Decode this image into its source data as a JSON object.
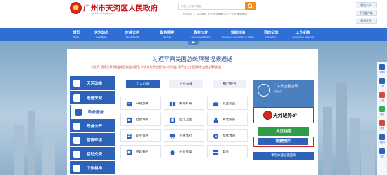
{
  "header": {
    "title": "广州市天河区人民政府",
    "url": "www.thnet.gov.cn",
    "search_placeholder": "请输入关键字搜索",
    "hot_words": "热点词汇：  公共服务   产业扶持政策   学习十九大   营商环境",
    "top_buttons": [
      "微信公众",
      "手机客户端",
      "微博天河"
    ]
  },
  "nav": {
    "items": [
      {
        "zh": "首页",
        "en": "Home"
      },
      {
        "zh": "天河动态",
        "en": "Look News"
      },
      {
        "zh": "走进天河",
        "en": "About Tianhe"
      },
      {
        "zh": "政务服务",
        "en": "Services"
      },
      {
        "zh": "政务公开",
        "en": "Government affairs"
      },
      {
        "zh": "营商环境",
        "en": "Business & Investment in Tianhe"
      },
      {
        "zh": "互动交流",
        "en": "Interaction"
      },
      {
        "zh": "工作机构",
        "en": "Government Agencies"
      }
    ]
  },
  "main": {
    "headline": "习近平同美国总统拜登视频通话",
    "summary": "习近平：国家关系不能变来回或相向而行，冲突对抗不符合任何人的利益，和平安全才是国际社会最宝贵的财富",
    "sidebar": [
      {
        "label": "天河动态",
        "active": false
      },
      {
        "label": "走进天河",
        "active": false
      },
      {
        "label": "政务服务",
        "active": true
      },
      {
        "label": "政务公开",
        "active": false
      },
      {
        "label": "营商环境",
        "active": false
      },
      {
        "label": "互动交流",
        "active": false
      },
      {
        "label": "工作机构",
        "active": false
      }
    ],
    "tabs": [
      "个人办事",
      "企业办事",
      "部门服务"
    ],
    "services": [
      {
        "label": "户籍办事",
        "icon": "household-icon",
        "color": "#2c63b9"
      },
      {
        "label": "教育科研",
        "icon": "education-icon",
        "color": "#2c63b9"
      },
      {
        "label": "就业创业",
        "icon": "employment-icon",
        "color": "#2c63b9"
      },
      {
        "label": "社会保障",
        "icon": "social-security-icon",
        "color": "#2c63b9"
      },
      {
        "label": "医疗卫生",
        "icon": "medical-icon",
        "color": "#2c63b9"
      },
      {
        "label": "养老服务",
        "icon": "elderly-care-icon",
        "color": "#2c63b9"
      },
      {
        "label": "职业资格",
        "icon": "qualification-icon",
        "color": "#2c63b9"
      },
      {
        "label": "交通出行",
        "icon": "transport-icon",
        "color": "#2c63b9"
      },
      {
        "label": "文化体育",
        "icon": "culture-sports-icon",
        "color": "#2c63b9"
      },
      {
        "label": "民政事务",
        "icon": "civil-affairs-icon",
        "color": "#2c63b9"
      },
      {
        "label": "住房保障",
        "icon": "housing-icon",
        "color": "#2c63b9"
      },
      {
        "label": "其他",
        "icon": "other-icon",
        "color": "#2c63b9"
      }
    ],
    "right": {
      "qr_title": "广东政务服务网",
      "qr_subtitle": "天河分厅",
      "tianhe_e": "天河政务e°",
      "guide": "大厅指引",
      "appointment": "我要预约",
      "process": "事项办理进度查询"
    }
  },
  "float_bar": [
    "无障碍",
    "长者",
    "关注",
    "微信",
    "微博",
    "手机版",
    "返回"
  ],
  "colors": {
    "brand_red": "#c4141b",
    "nav_blue": "#2f6fd4",
    "panel_blue": "#2c63b9",
    "guide_green": "#2f9c47",
    "search_orange": "#f58d1d"
  }
}
